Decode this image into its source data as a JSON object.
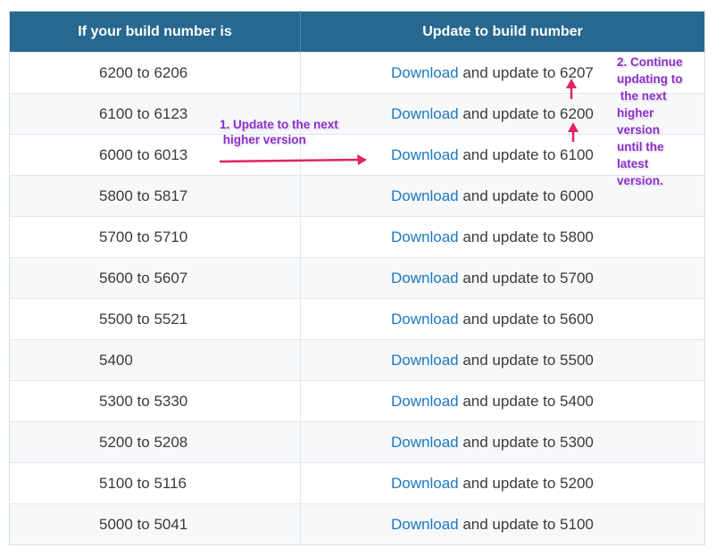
{
  "table": {
    "headers": [
      "If your build number is",
      "Update to build number"
    ],
    "download_label": "Download",
    "rows": [
      {
        "range": "6200 to 6206",
        "rest": " and update to 6207"
      },
      {
        "range": "6100 to 6123",
        "rest": " and update to 6200"
      },
      {
        "range": "6000 to 6013",
        "rest": " and update to 6100"
      },
      {
        "range": "5800 to 5817",
        "rest": " and update to 6000"
      },
      {
        "range": "5700 to 5710",
        "rest": " and update to 5800"
      },
      {
        "range": "5600 to 5607",
        "rest": " and update to 5700"
      },
      {
        "range": "5500 to 5521",
        "rest": " and update to 5600"
      },
      {
        "range": "5400",
        "rest": " and update to 5500"
      },
      {
        "range": "5300 to 5330",
        "rest": " and update to 5400"
      },
      {
        "range": "5200 to 5208",
        "rest": " and update to 5300"
      },
      {
        "range": "5100 to 5116",
        "rest": " and update to 5200"
      },
      {
        "range": "5000 to 5041",
        "rest": " and update to 5100"
      }
    ]
  },
  "annotations": {
    "note1_lines": [
      "1. Update to the next",
      " higher version"
    ],
    "note2_lines": [
      "2. Continue",
      "updating to",
      " the next",
      "higher",
      "version",
      "until the",
      "latest",
      "version."
    ]
  },
  "colors": {
    "header_bg": "#26688f",
    "link": "#1d78c1",
    "annotation_text": "#8b2fc9",
    "arrow": "#e0245e"
  }
}
